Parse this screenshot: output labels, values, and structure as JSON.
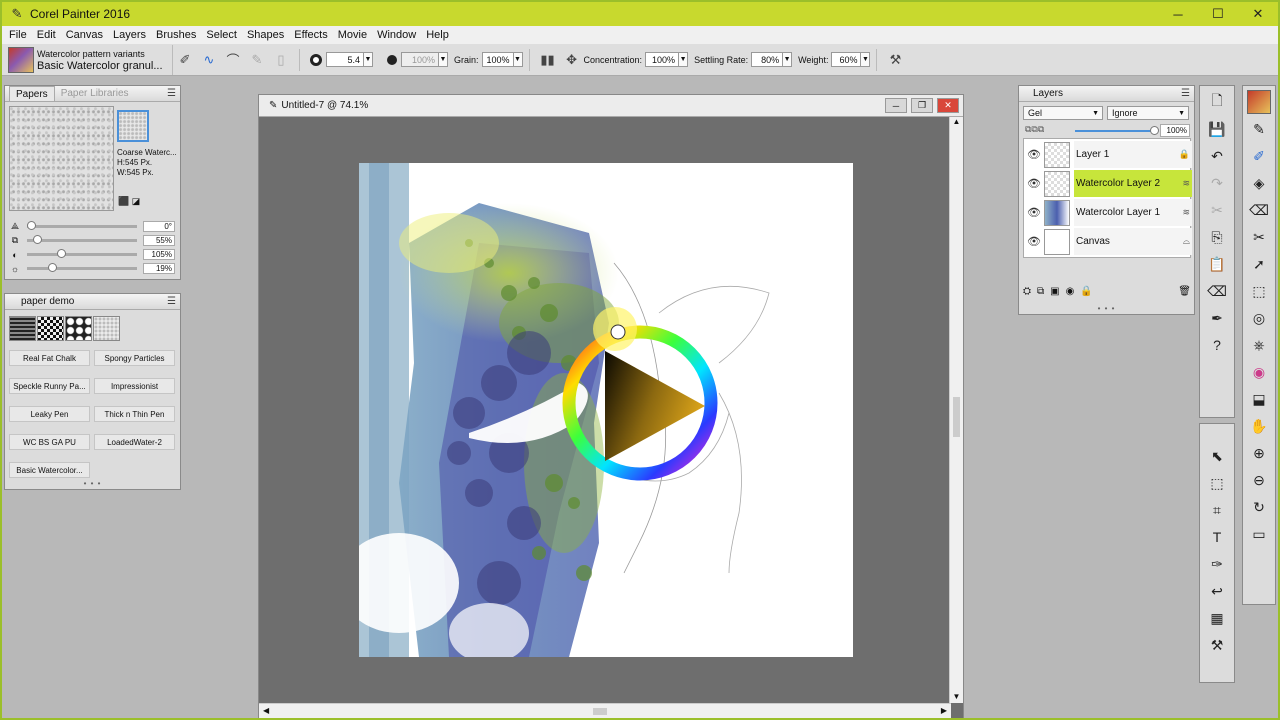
{
  "app": {
    "title": "Corel Painter 2016",
    "window_controls": [
      "─",
      "☐",
      "✕"
    ]
  },
  "menu": [
    "File",
    "Edit",
    "Canvas",
    "Layers",
    "Brushes",
    "Select",
    "Shapes",
    "Effects",
    "Movie",
    "Window",
    "Help"
  ],
  "property_bar": {
    "brush_category": "Watercolor pattern variants",
    "brush_variant": "Basic Watercolor granul...",
    "size": "5.4",
    "opacity": "100%",
    "grain_label": "Grain:",
    "grain": "100%",
    "concentration_label": "Concentration:",
    "concentration": "100%",
    "settling_label": "Settling Rate:",
    "settling": "80%",
    "weight_label": "Weight:",
    "weight": "60%"
  },
  "papers_panel": {
    "tab_papers": "Papers",
    "tab_libraries": "Paper Libraries",
    "paper_name": "Coarse Waterc...",
    "height": "H:545 Px.",
    "width": "W:545 Px.",
    "sliders": [
      {
        "icon": "angle-icon",
        "value": "0°",
        "level": 0
      },
      {
        "icon": "scale-icon",
        "value": "55%",
        "level": 0.05
      },
      {
        "icon": "contrast-icon",
        "value": "105%",
        "level": 0.27
      },
      {
        "icon": "brightness-icon",
        "value": "19%",
        "level": 0.19
      }
    ]
  },
  "paper_demo": {
    "title": "paper demo",
    "brushes": [
      "Real Fat Chalk",
      "Spongy Particles",
      "Speckle Runny Pa...",
      "Impressionist",
      "Leaky Pen",
      "Thick n Thin Pen",
      "WC BS GA PU",
      "LoadedWater-2",
      "Basic Watercolor..."
    ]
  },
  "document": {
    "title": "Untitled-7 @ 74.1%"
  },
  "layers_panel": {
    "title": "Layers",
    "composite_method": "Gel",
    "preserve": "Ignore",
    "opacity": "100%",
    "layers": [
      {
        "name": "Layer 1",
        "selected": false
      },
      {
        "name": "Watercolor Layer 2",
        "selected": true
      },
      {
        "name": "Watercolor Layer 1",
        "selected": false
      },
      {
        "name": "Canvas",
        "selected": false
      }
    ]
  },
  "colors": {
    "selected_layer": "#c7e53b",
    "title_bar": "#c8d92e",
    "desktop": "#9bbf2a"
  }
}
